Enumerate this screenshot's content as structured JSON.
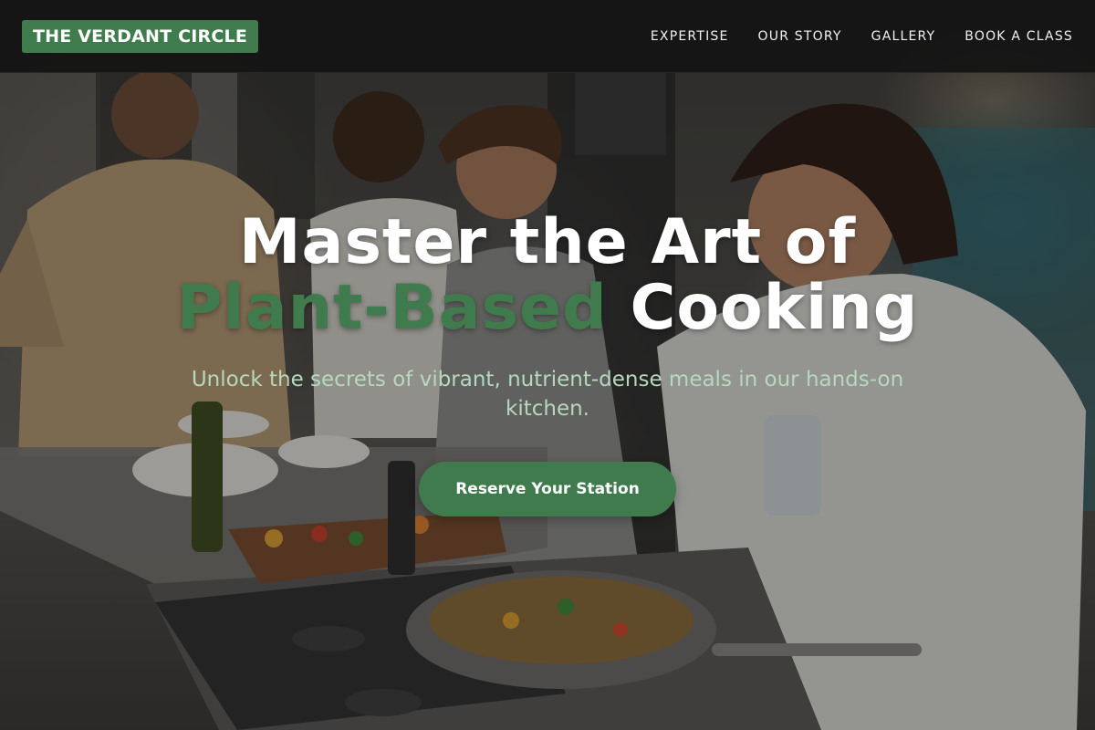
{
  "brand": {
    "name": "THE VERDANT CIRCLE",
    "color": "#3f7b4d"
  },
  "nav": {
    "items": [
      {
        "label": "EXPERTISE"
      },
      {
        "label": "OUR STORY"
      },
      {
        "label": "GALLERY"
      },
      {
        "label": "BOOK A CLASS"
      }
    ]
  },
  "hero": {
    "title_line1": "Master the Art of",
    "title_accent": "Plant-Based",
    "title_line2_rest": " Cooking",
    "subtitle": "Unlock the secrets of vibrant, nutrient-dense meals in our hands-on kitchen.",
    "cta_label": "Reserve Your Station",
    "background_image": "people-cooking-in-kitchen-photo",
    "accent_color": "#3f7b4d",
    "subtitle_color": "#b6d8bd"
  }
}
